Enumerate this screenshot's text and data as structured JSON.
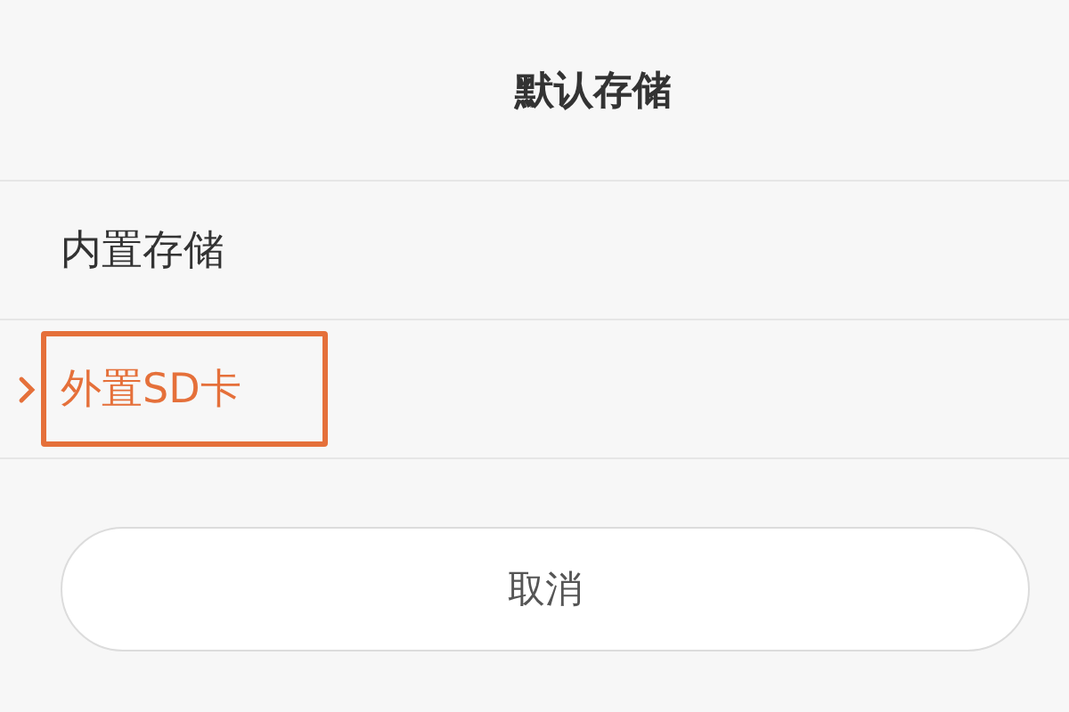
{
  "dialog": {
    "title": "默认存储"
  },
  "options": [
    {
      "label": "内置存储",
      "selected": false
    },
    {
      "label": "外置SD卡",
      "selected": true
    }
  ],
  "cancel_button": {
    "label": "取消"
  }
}
